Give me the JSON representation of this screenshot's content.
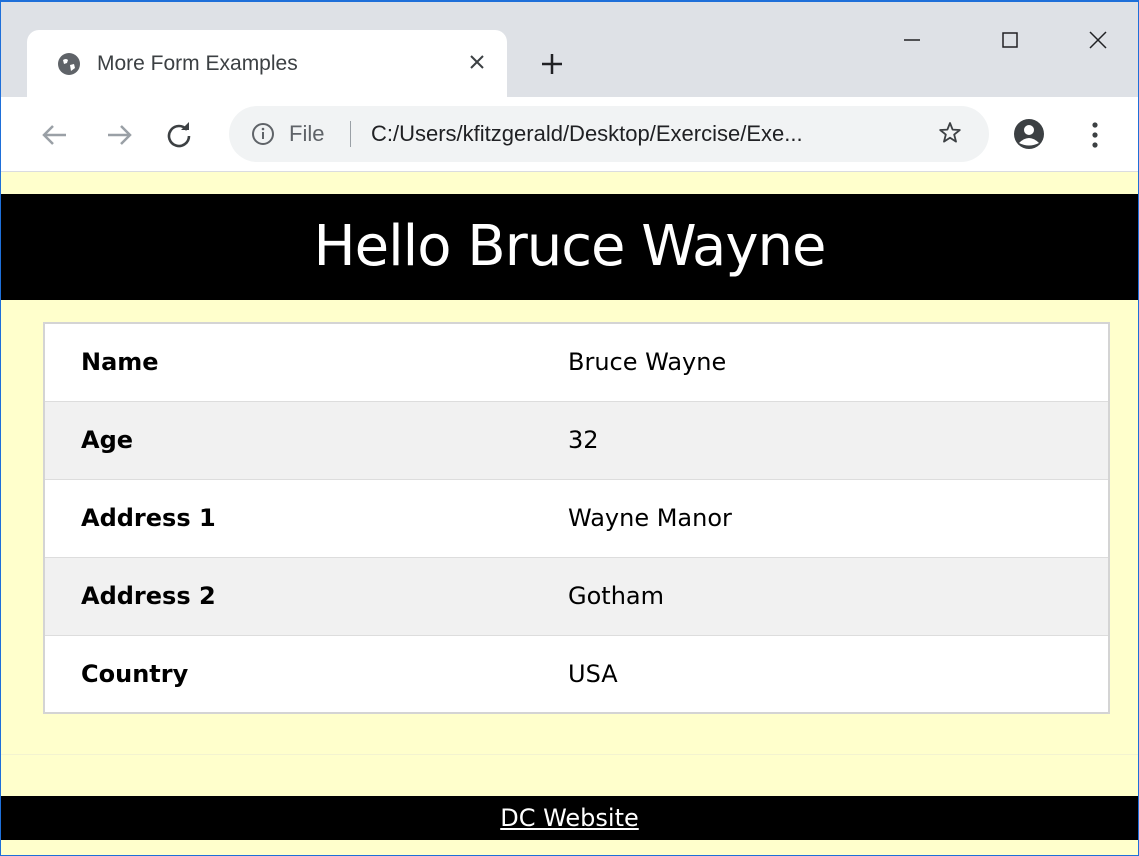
{
  "browser": {
    "tab_title": "More Form Examples",
    "address_scheme": "File",
    "address_url": "C:/Users/kfitzgerald/Desktop/Exercise/Exe..."
  },
  "page": {
    "heading": "Hello Bruce Wayne",
    "details": [
      {
        "label": "Name",
        "value": "Bruce Wayne"
      },
      {
        "label": "Age",
        "value": "32"
      },
      {
        "label": "Address 1",
        "value": "Wayne Manor"
      },
      {
        "label": "Address 2",
        "value": "Gotham"
      },
      {
        "label": "Country",
        "value": "USA"
      }
    ],
    "footer_link": "DC Website"
  },
  "colors": {
    "page_background": "#ffffcc",
    "banner_background": "#000000",
    "banner_text": "#ffffff",
    "row_alt": "#f1f1f1"
  }
}
